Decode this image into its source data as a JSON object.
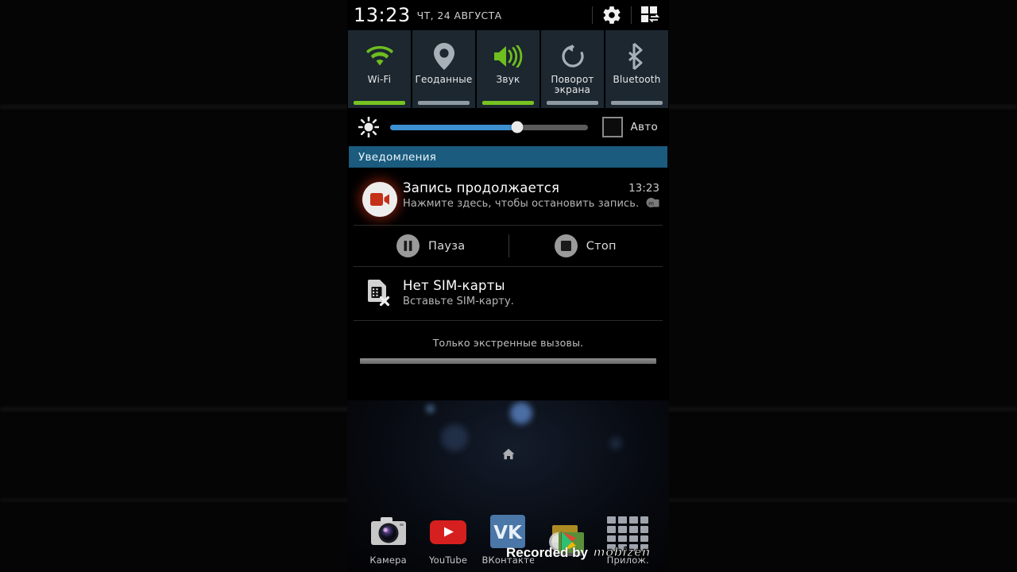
{
  "statusbar": {
    "time": "13:23",
    "date": "ЧТ, 24 АВГУСТА",
    "settings_icon": "gear-icon",
    "quick_toggle_icon": "grid-switch-icon"
  },
  "quick_toggles": [
    {
      "label": "Wi-Fi",
      "icon": "wifi-icon",
      "active": true,
      "bar_color": "#76c322"
    },
    {
      "label": "Геоданные",
      "icon": "location-icon",
      "active": false,
      "bar_color": "#8d9aa3"
    },
    {
      "label": "Звук",
      "icon": "volume-icon",
      "active": true,
      "bar_color": "#76c322"
    },
    {
      "label": "Поворот\nэкрана",
      "icon": "rotate-icon",
      "active": false,
      "bar_color": "#8d9aa3"
    },
    {
      "label": "Bluetooth",
      "icon": "bluetooth-icon",
      "active": false,
      "bar_color": "#8d9aa3"
    }
  ],
  "toggle_labels": {
    "wifi": "Wi-Fi",
    "geodata": "Геоданные",
    "sound": "Звук",
    "rotate": "Поворот экрана",
    "bluetooth": "Bluetooth"
  },
  "brightness": {
    "icon": "brightness-icon",
    "value_percent": 64,
    "auto_label": "Авто",
    "auto_checked": false,
    "fill_color": "#3d8fd0",
    "track_color": "#5b5b5b"
  },
  "notifications_header": {
    "title": "Уведомления",
    "bg_color": "#1a5b7e"
  },
  "notifications": [
    {
      "icon": "video-record-icon",
      "title": "Запись продолжается",
      "subtitle": "Нажмите здесь, чтобы остановить запись.",
      "time": "13:23",
      "badge_icon": "mobizen-icon",
      "actions": [
        {
          "label": "Пауза",
          "icon": "pause-icon"
        },
        {
          "label": "Стоп",
          "icon": "stop-icon"
        }
      ]
    },
    {
      "icon": "sim-card-error-icon",
      "title": "Нет SIM-карты",
      "subtitle": "Вставьте SIM-карту.",
      "time": "",
      "actions": []
    }
  ],
  "panel_footer": {
    "emergency_text": "Только экстренные вызовы.",
    "handle_icon": "drag-handle"
  },
  "home": {
    "home_indicator_icon": "home-icon",
    "dock": [
      {
        "label": "Камера",
        "icon": "camera-app-icon"
      },
      {
        "label": "YouTube",
        "icon": "youtube-app-icon"
      },
      {
        "label": "ВКонтакте",
        "icon": "vk-app-icon"
      },
      {
        "label": "",
        "icon": "play-store-app-icon"
      },
      {
        "label": "Прилож.",
        "icon": "app-drawer-icon"
      }
    ]
  },
  "watermark": {
    "prefix": "Recorded by",
    "brand": "mobizen"
  },
  "colors": {
    "accent_green": "#76c322",
    "accent_blue": "#3d8fd0",
    "header_blue": "#1a5b7e",
    "toggle_bg": "#1c2730",
    "record_red": "#c43018"
  }
}
